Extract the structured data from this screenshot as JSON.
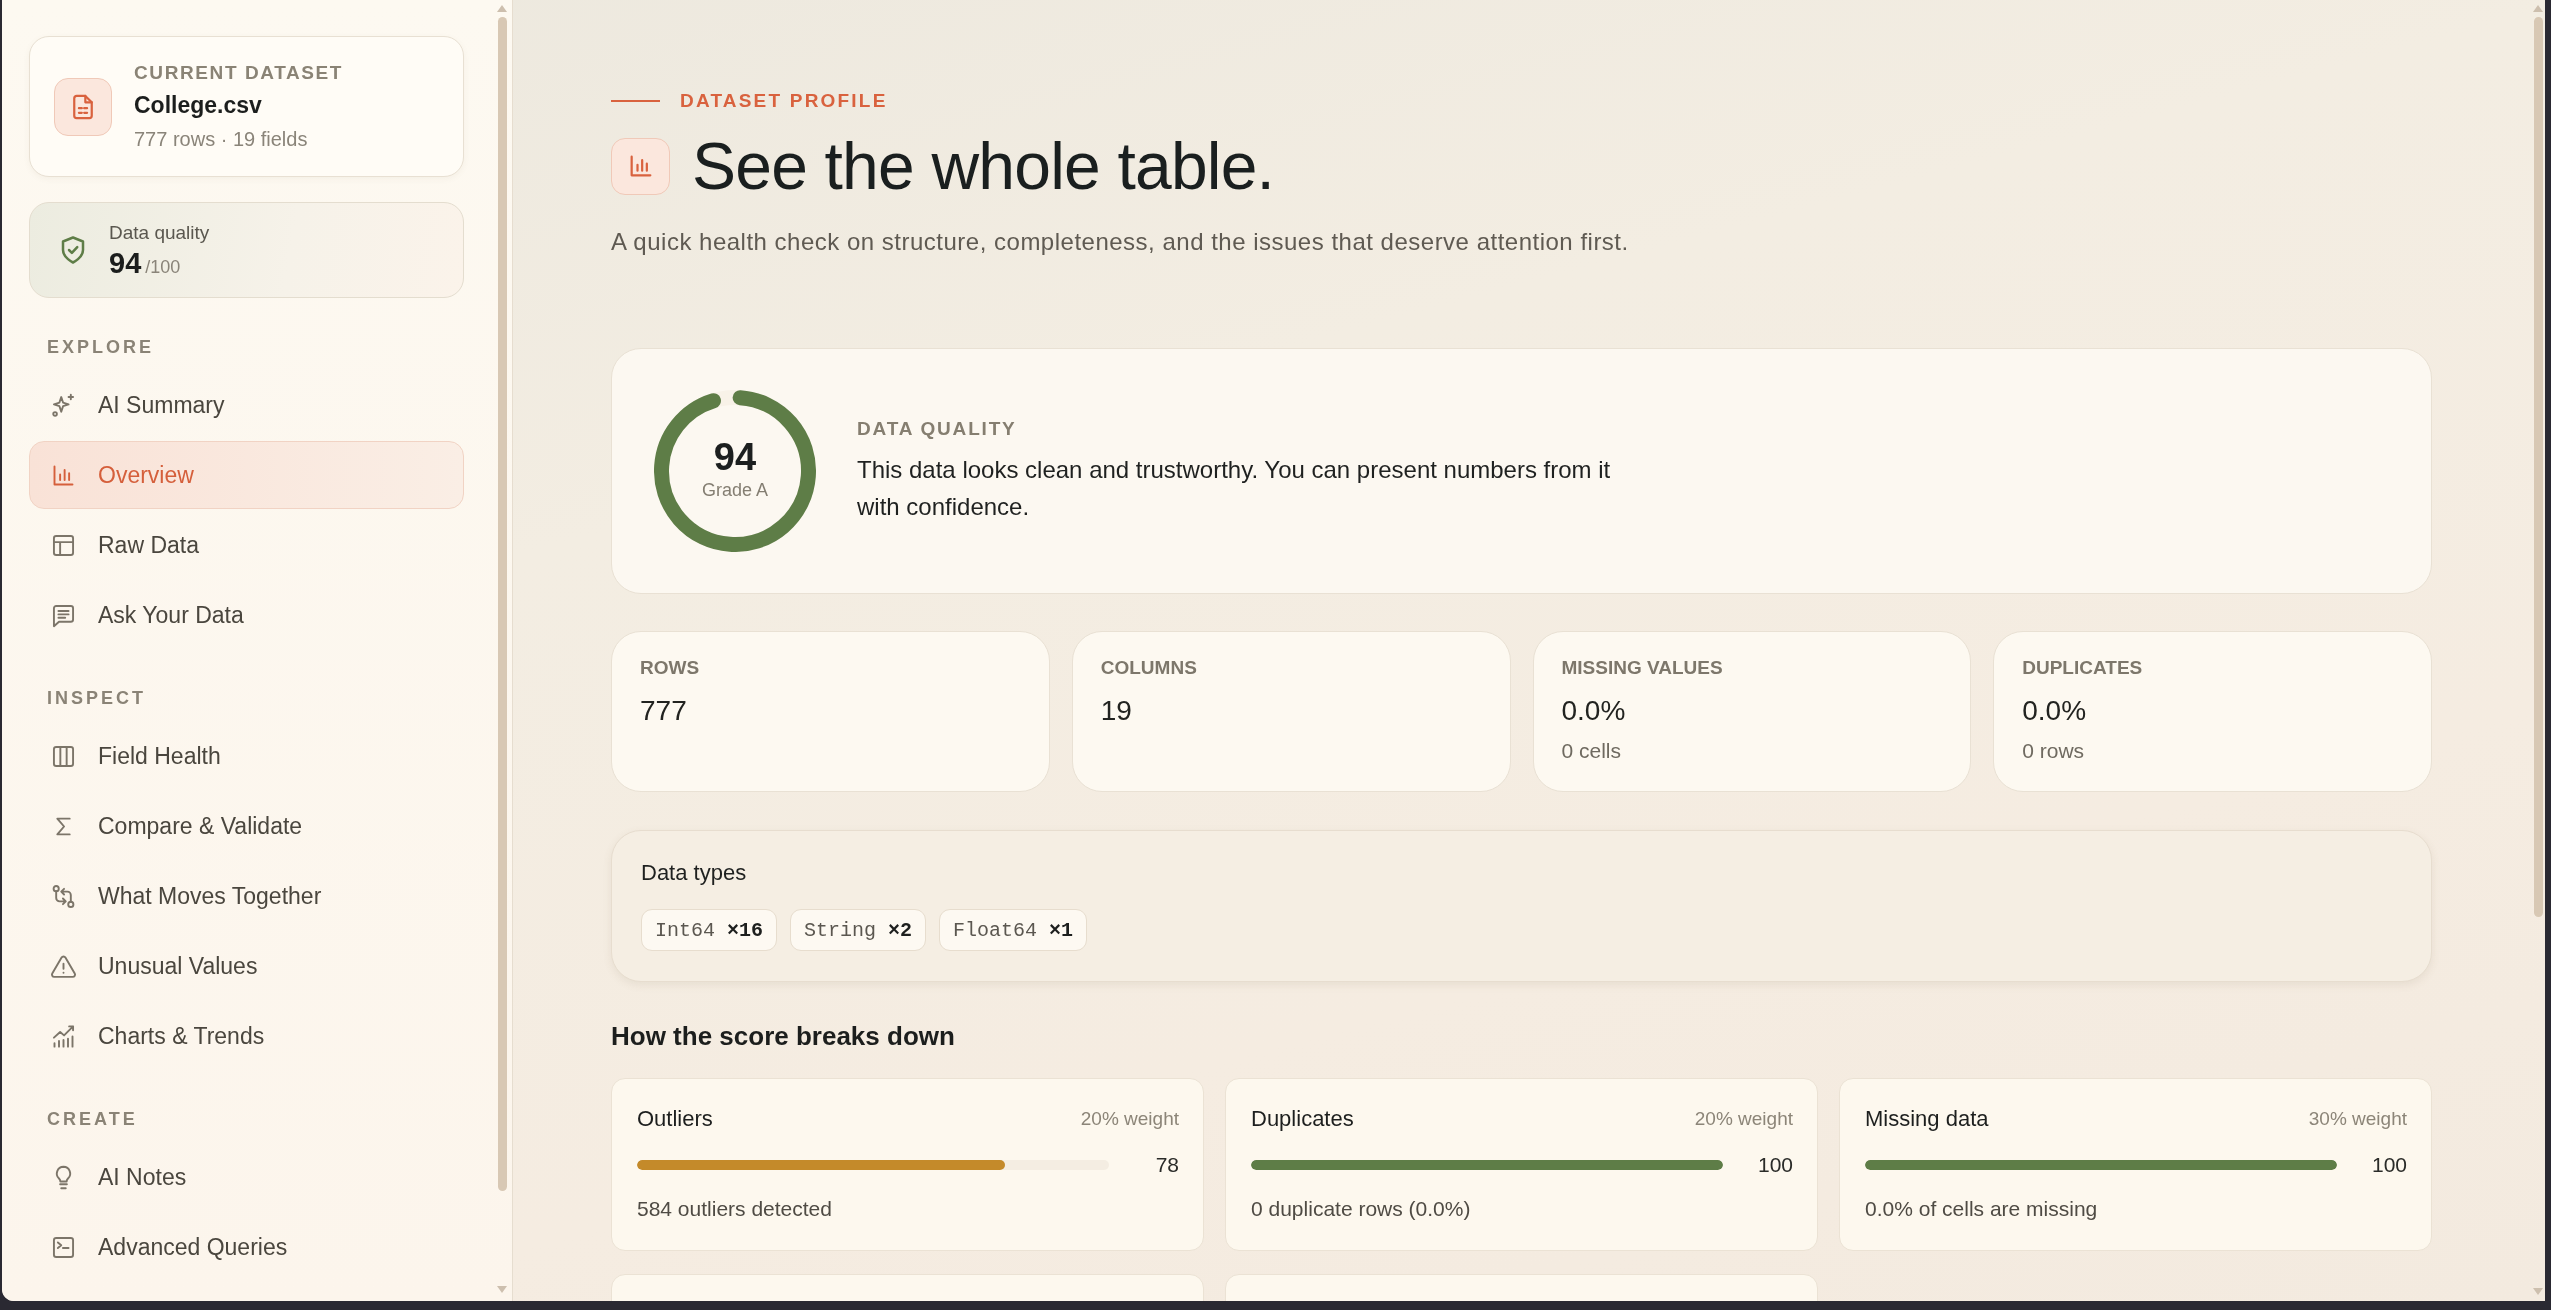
{
  "sidebar": {
    "dataset": {
      "label": "CURRENT DATASET",
      "name": "College.csv",
      "meta": "777 rows · 19 fields"
    },
    "quality": {
      "label": "Data quality",
      "score": "94",
      "max": "/100"
    },
    "sections": [
      {
        "title": "EXPLORE",
        "items": [
          {
            "label": "AI Summary",
            "selected": false
          },
          {
            "label": "Overview",
            "selected": true
          },
          {
            "label": "Raw Data",
            "selected": false
          },
          {
            "label": "Ask Your Data",
            "selected": false
          }
        ]
      },
      {
        "title": "INSPECT",
        "items": [
          {
            "label": "Field Health",
            "selected": false
          },
          {
            "label": "Compare & Validate",
            "selected": false
          },
          {
            "label": "What Moves Together",
            "selected": false
          },
          {
            "label": "Unusual Values",
            "selected": false
          },
          {
            "label": "Charts & Trends",
            "selected": false
          }
        ]
      },
      {
        "title": "CREATE",
        "items": [
          {
            "label": "AI Notes",
            "selected": false
          },
          {
            "label": "Advanced Queries",
            "selected": false
          }
        ]
      }
    ]
  },
  "header": {
    "eyebrow": "DATASET PROFILE",
    "title": "See the whole table.",
    "subtitle": "A quick health check on structure, completeness, and the issues that deserve attention first."
  },
  "quality": {
    "score": "94",
    "grade": "Grade A",
    "level": 0.94,
    "label": "DATA QUALITY",
    "summary": "This data looks clean and trustworthy. You can present numbers from it with confidence."
  },
  "stats": [
    {
      "label": "ROWS",
      "value": "777"
    },
    {
      "label": "COLUMNS",
      "value": "19"
    },
    {
      "label": "MISSING VALUES",
      "value": "0.0%",
      "note": "0 cells"
    },
    {
      "label": "DUPLICATES",
      "value": "0.0%",
      "note": "0 rows"
    }
  ],
  "data_types": {
    "title": "Data types",
    "chips": [
      "Int64 **×16**",
      "String **×2**",
      "Float64 **×1**"
    ]
  },
  "score_breakdown": {
    "title": "How the score breaks down",
    "items": [
      {
        "kind": "metric",
        "name": "Outliers",
        "weight": "20% weight",
        "level": 0.78,
        "score": "78",
        "color": "#c48a2a",
        "note": "584 outliers detected"
      },
      {
        "kind": "metric",
        "name": "Duplicates",
        "weight": "20% weight",
        "level": 1,
        "score": "100",
        "color": "#5e7d47",
        "note": "0 duplicate rows (0.0%)"
      },
      {
        "kind": "metric",
        "name": "Missing data",
        "weight": "30% weight",
        "level": 1,
        "score": "100",
        "color": "#5e7d47",
        "note": "0.0% of cells are missing"
      },
      {
        "kind": "cut_off"
      },
      {
        "kind": "cut_off"
      }
    ]
  }
}
